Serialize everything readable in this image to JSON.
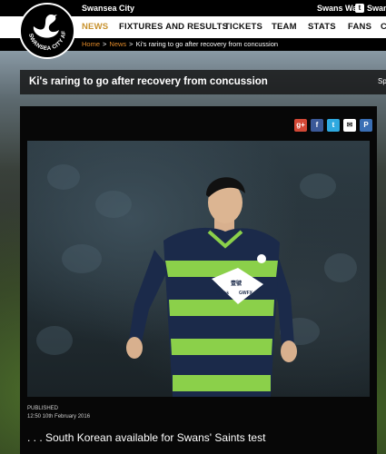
{
  "topbar": {
    "club_name": "Swansea City",
    "swans_wall": "Swans Wall",
    "twitter_glyph": "t",
    "swans_right": "Swan"
  },
  "nav": {
    "items": [
      "NEWS",
      "FIXTURES AND RESULTS",
      "TICKETS",
      "TEAM",
      "STATS",
      "FANS",
      "C"
    ],
    "active_index": 0
  },
  "breadcrumb": {
    "home": "Home",
    "sep1": ">",
    "news": "News",
    "sep2": ">",
    "current": "Ki's raring to go after recovery from concussion"
  },
  "logo": {
    "text": "SWANSEA CITY AFC",
    "icon": "swan-crest-icon"
  },
  "title_band": {
    "title": "Ki's raring to go after recovery from concussion",
    "right_text": "Sp"
  },
  "share": {
    "icons": [
      "google-plus-icon",
      "facebook-icon",
      "twitter-icon",
      "email-icon",
      "print-icon"
    ],
    "labels": [
      "g+",
      "f",
      "t",
      "✉",
      "P"
    ],
    "colors": [
      "#d34836",
      "#3b5998",
      "#2fa9e0",
      "#ffffff",
      "#3a6fb5"
    ]
  },
  "article": {
    "published_label": "PUBLISHED",
    "published_date": "12:50 10th February 2016",
    "subtitle": ". . . South Korean available for Swans' Saints test"
  },
  "photo": {
    "shirt_sponsor": "GWFX",
    "shirt_sponsor_small": "24k.hk",
    "shirt_glyph": "壹號"
  },
  "colors": {
    "accent": "#c8922e",
    "breadcrumb_link": "#e08a2a",
    "kit_green": "#8bd04a",
    "kit_navy": "#1b2a4a"
  }
}
